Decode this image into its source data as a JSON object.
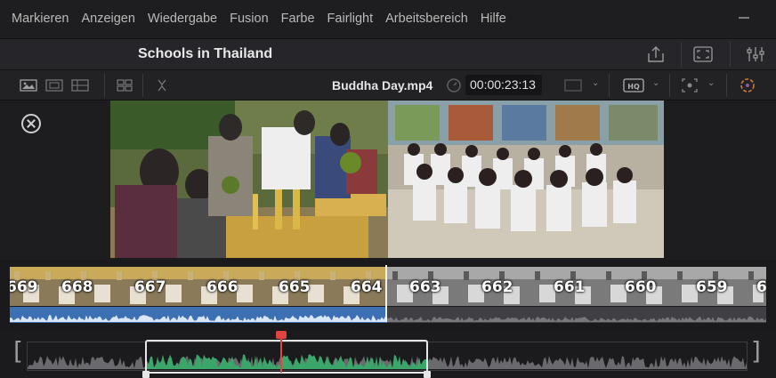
{
  "menu": {
    "items": [
      "Markieren",
      "Anzeigen",
      "Wiedergabe",
      "Fusion",
      "Farbe",
      "Fairlight",
      "Arbeitsbereich",
      "Hilfe"
    ]
  },
  "titlebar": {
    "project_title": "Schools in Thailand",
    "icons": [
      "share-icon",
      "fullscreen-icon",
      "mixer-icon"
    ]
  },
  "viewer_toolbar": {
    "clip_name": "Buddha Day.mp4",
    "timecode": "00:00:23:13",
    "icons": [
      "image-view-icon",
      "safe-area-icon",
      "film-strip-icon",
      "grid-icon",
      "trim-icon",
      "speed-icon",
      "monitor-icon",
      "hq-icon",
      "transform-icon",
      "color-wheel-icon"
    ]
  },
  "strip": {
    "frame_numbers": [
      "669",
      "668",
      "667",
      "666",
      "665",
      "664",
      "663",
      "662",
      "661",
      "660",
      "659",
      "6"
    ]
  },
  "colors": {
    "accent_playhead": "#e0463f",
    "audio_active": "#3d6fb3",
    "waveform_green": "#3aa66a"
  }
}
